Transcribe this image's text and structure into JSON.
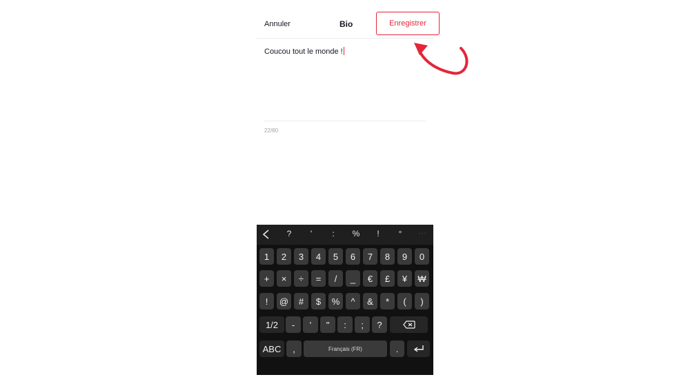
{
  "header": {
    "cancel_label": "Annuler",
    "title": "Bio",
    "save_label": "Enregistrer"
  },
  "bio": {
    "text": "Coucou tout le monde !",
    "counter": "22/80"
  },
  "keyboard": {
    "toolbar": [
      "?",
      "'",
      ":",
      "%",
      "!",
      "°"
    ],
    "row_numbers": [
      "1",
      "2",
      "3",
      "4",
      "5",
      "6",
      "7",
      "8",
      "9",
      "0"
    ],
    "row_symbols1": [
      "+",
      "×",
      "÷",
      "=",
      "/",
      "_",
      "€",
      "£",
      "¥",
      "₩"
    ],
    "row_symbols2": [
      "!",
      "@",
      "#",
      "$",
      "%",
      "^",
      "&",
      "*",
      "(",
      ")"
    ],
    "row_symbols3": {
      "mode_key": "1/2",
      "keys": [
        "-",
        "'",
        "\"",
        ":",
        ";",
        "?"
      ]
    },
    "bottom": {
      "abc_key": "ABC",
      "comma_key": ",",
      "space_label": "Français (FR)",
      "period_key": "."
    }
  },
  "colors": {
    "accent": "#e3263a",
    "keyboard_bg": "#111111",
    "key_bg": "#3a3a3a"
  }
}
